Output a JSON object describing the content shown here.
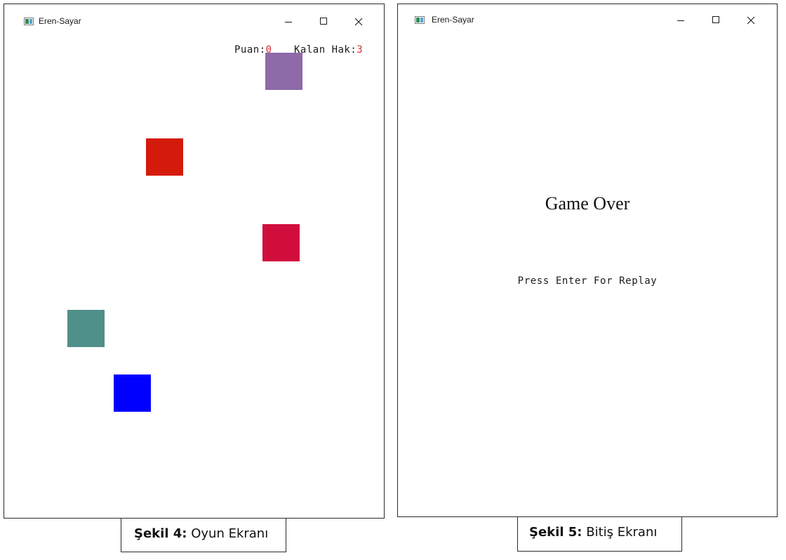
{
  "windows": {
    "game": {
      "title": "Eren-Sayar",
      "hud": {
        "score_label": "Puan:",
        "score_value": "0",
        "lives_label": "Kalan Hak:",
        "lives_value": "3"
      },
      "squares": [
        {
          "name": "purple-square",
          "color": "#8e6aa8"
        },
        {
          "name": "red-square",
          "color": "#d41a0a"
        },
        {
          "name": "crimson-square",
          "color": "#d10d3e"
        },
        {
          "name": "teal-square",
          "color": "#518f8a"
        },
        {
          "name": "blue-square",
          "color": "#0000ff"
        }
      ]
    },
    "game_over": {
      "title": "Eren-Sayar",
      "heading": "Game Over",
      "hint": "Press Enter For Replay"
    }
  },
  "captions": {
    "figure4": {
      "label": "Şekil 4:",
      "text": "Oyun Ekranı"
    },
    "figure5": {
      "label": "Şekil 5:",
      "text": "Bitiş Ekranı"
    }
  },
  "colors": {
    "hud_number": "#d63040",
    "background": "#ffffff"
  }
}
